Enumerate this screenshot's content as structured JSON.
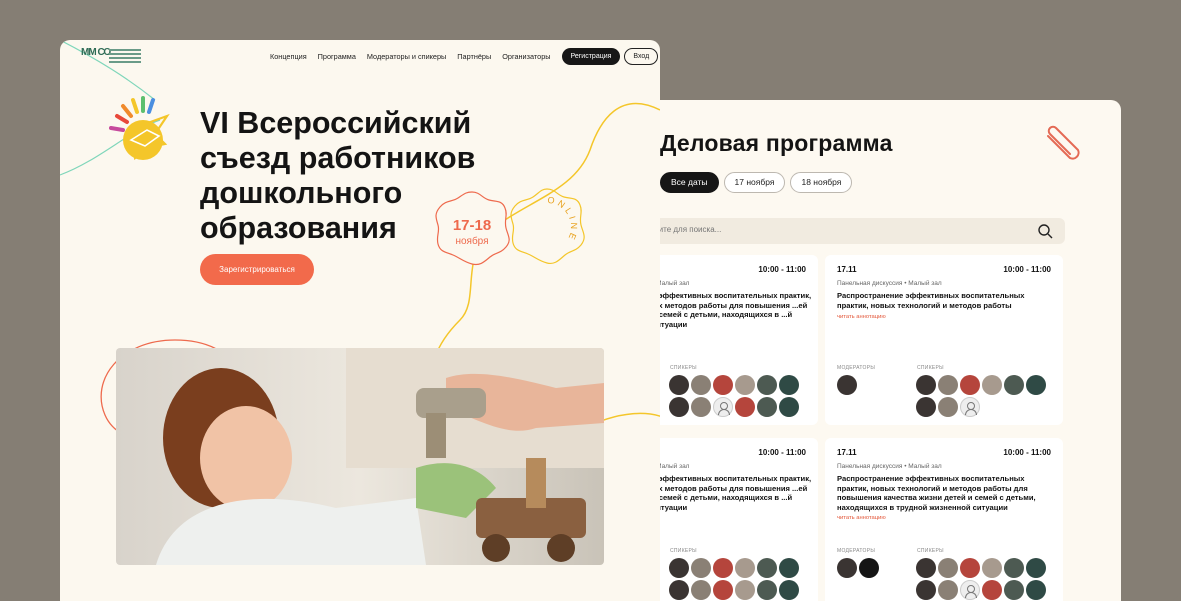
{
  "program": {
    "title": "Деловая программа",
    "filters": [
      "Все даты",
      "17 ноября",
      "18 ноября"
    ],
    "search_placeholder": "...ите для поиска...",
    "cards": [
      {
        "date": "",
        "time": "10:00 - 11:00",
        "meta": "• Малый зал",
        "title": "...эффективных воспитательных практик, ...х методов работы для повышения ...ей и семей с детьми, находящихся в ...й ситуации",
        "more": "",
        "moderators_label": "",
        "speakers_label": "СПИКЕРЫ"
      },
      {
        "date": "17.11",
        "time": "10:00 - 11:00",
        "meta": "Панельная дискуссия • Малый зал",
        "title": "Распространение эффективных воспитательных практик, новых технологий и методов работы",
        "more": "читать аннотацию",
        "moderators_label": "МОДЕРАТОРЫ",
        "speakers_label": "СПИКЕРЫ"
      },
      {
        "date": "",
        "time": "10:00 - 11:00",
        "meta": "• Малый зал",
        "title": "...эффективных воспитательных практик, ...х методов работы для повышения ...ей и семей с детьми, находящихся в ...й ситуации",
        "more": "",
        "moderators_label": "",
        "speakers_label": "СПИКЕРЫ"
      },
      {
        "date": "17.11",
        "time": "10:00 - 11:00",
        "meta": "Панельная дискуссия • Малый зал",
        "title": "Распространение эффективных воспитательных практик, новых технологий и методов работы для повышения качества жизни детей и семей с детьми, находящихся в трудной жизненной ситуации",
        "more": "читать аннотацию",
        "moderators_label": "МОДЕРАТОРЫ",
        "speakers_label": "СПИКЕРЫ"
      }
    ]
  },
  "site": {
    "logo_text": "ММ СО",
    "nav": [
      "Концепция",
      "Программа",
      "Модераторы и спикеры",
      "Партнёры",
      "Организаторы"
    ],
    "register_label": "Регистрация",
    "login_label": "Вход",
    "hero_title": "VI Всероссийский съезд работников дошкольного образования",
    "badge_date": "17-18",
    "badge_month": "ноября",
    "badge_online": "ONLINE",
    "cta_label": "Зарегистрироваться"
  },
  "colors": {
    "accent": "#f26a4b",
    "dark": "#161616",
    "panel": "#fcf8ef",
    "background": "#857e74",
    "yellow_line": "#f4c62a",
    "brand_green": "#2e6b55"
  }
}
